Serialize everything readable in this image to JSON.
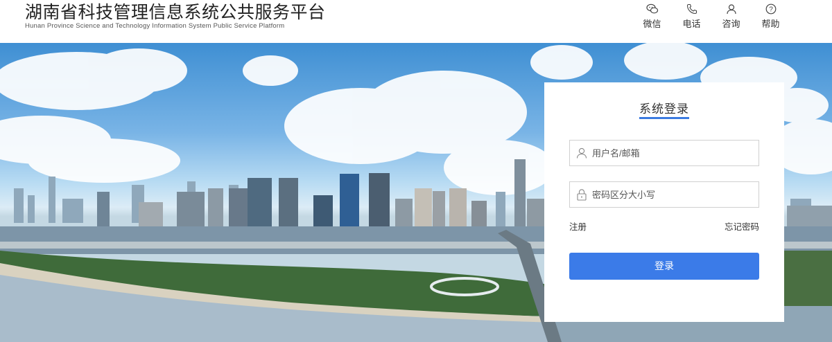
{
  "header": {
    "title_cn": "湖南省科技管理信息系统公共服务平台",
    "title_en": "Hunan Province Science and Technology Information System Public Service Platform",
    "nav": [
      {
        "label": "微信",
        "icon": "wechat-icon"
      },
      {
        "label": "电话",
        "icon": "phone-icon"
      },
      {
        "label": "咨询",
        "icon": "consult-icon"
      },
      {
        "label": "帮助",
        "icon": "help-icon"
      }
    ]
  },
  "login": {
    "title": "系统登录",
    "username_placeholder": "用户名/邮箱",
    "password_placeholder": "密码区分大小写",
    "register_label": "注册",
    "forgot_label": "忘记密码",
    "submit_label": "登录"
  },
  "colors": {
    "accent": "#3b7be8",
    "sky": "#79b4e6"
  }
}
